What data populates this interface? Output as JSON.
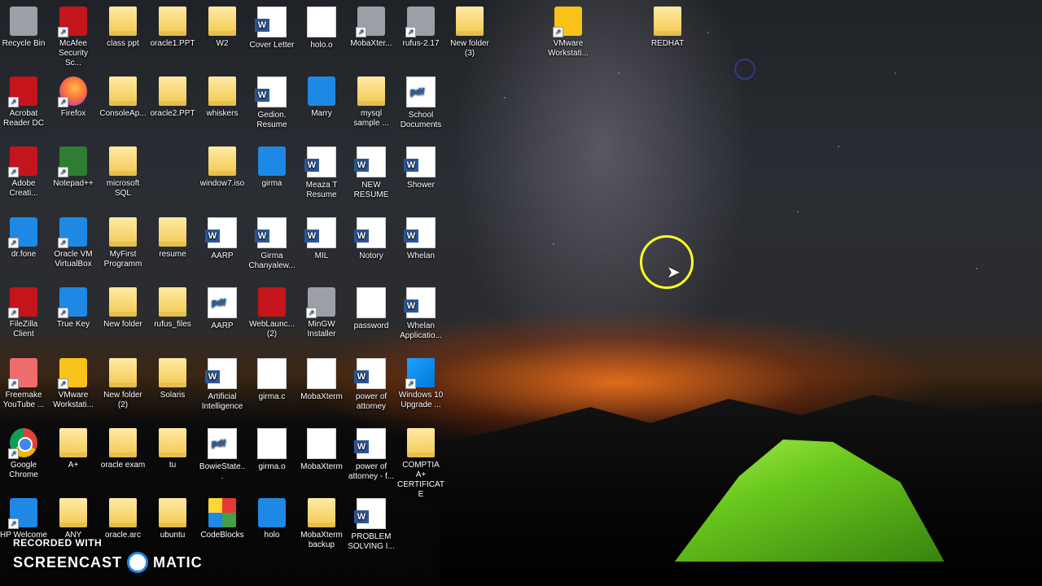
{
  "desktop": {
    "icons": [
      {
        "label": "Recycle Bin",
        "type": "gray"
      },
      {
        "label": "McAfee Security Sc...",
        "type": "red"
      },
      {
        "label": "class ppt",
        "type": "folder"
      },
      {
        "label": "oracle1.PPT",
        "type": "folder"
      },
      {
        "label": "W2",
        "type": "folder"
      },
      {
        "label": "Cover Letter",
        "type": "word"
      },
      {
        "label": "holo.o",
        "type": "doc"
      },
      {
        "label": "MobaXter...",
        "type": "gray"
      },
      {
        "label": "rufus-2.17",
        "type": "gray"
      },
      {
        "label": "New folder (3)",
        "type": "folder"
      },
      {
        "label": "VMware Workstati...",
        "type": "yellow"
      },
      {
        "label": "REDHAT",
        "type": "folder"
      },
      {
        "label": "Acrobat Reader DC",
        "type": "red"
      },
      {
        "label": "Firefox",
        "type": "firefox"
      },
      {
        "label": "ConsoleAp...",
        "type": "folder"
      },
      {
        "label": "oracle2.PPT",
        "type": "folder"
      },
      {
        "label": "whiskers",
        "type": "folder"
      },
      {
        "label": "Gedion. Resume",
        "type": "word"
      },
      {
        "label": "Marry",
        "type": "blue"
      },
      {
        "label": "mysql sample ...",
        "type": "folder"
      },
      {
        "label": "School Documents",
        "type": "pdf"
      },
      {
        "label": "Adobe Creati...",
        "type": "red"
      },
      {
        "label": "Notepad++",
        "type": "green"
      },
      {
        "label": "microsoft SQL",
        "type": "folder"
      },
      {
        "label": "window7.iso",
        "type": "folder"
      },
      {
        "label": "girma",
        "type": "blue"
      },
      {
        "label": "Meaza T Resume",
        "type": "word"
      },
      {
        "label": "NEW RESUME",
        "type": "word"
      },
      {
        "label": "Shower",
        "type": "word"
      },
      {
        "label": "dr.fone",
        "type": "blue"
      },
      {
        "label": "Oracle VM VirtualBox",
        "type": "blue"
      },
      {
        "label": "MyFirst Programm",
        "type": "folder"
      },
      {
        "label": "resume",
        "type": "folder"
      },
      {
        "label": "AARP",
        "type": "word"
      },
      {
        "label": "Girma Chanyalew...",
        "type": "word"
      },
      {
        "label": "MIL",
        "type": "word"
      },
      {
        "label": "Notory",
        "type": "word"
      },
      {
        "label": "Whelan",
        "type": "word"
      },
      {
        "label": "FileZilla Client",
        "type": "red"
      },
      {
        "label": "True Key",
        "type": "blue"
      },
      {
        "label": "New folder",
        "type": "folder"
      },
      {
        "label": "rufus_files",
        "type": "folder"
      },
      {
        "label": "AARP",
        "type": "pdf"
      },
      {
        "label": "WebLaunc... (2)",
        "type": "red"
      },
      {
        "label": "MinGW Installer",
        "type": "gray"
      },
      {
        "label": "password",
        "type": "doc"
      },
      {
        "label": "Whelan Applicatio...",
        "type": "word"
      },
      {
        "label": "Freemake YouTube ...",
        "type": "pink"
      },
      {
        "label": "VMware Workstati...",
        "type": "yellow"
      },
      {
        "label": "New folder (2)",
        "type": "folder"
      },
      {
        "label": "Solaris",
        "type": "folder"
      },
      {
        "label": "Artificial Intelligence",
        "type": "word"
      },
      {
        "label": "girma.c",
        "type": "doc"
      },
      {
        "label": "MobaXterm",
        "type": "doc"
      },
      {
        "label": "power of attorney",
        "type": "word"
      },
      {
        "label": "Windows 10 Upgrade ...",
        "type": "win"
      },
      {
        "label": "Google Chrome",
        "type": "chrome"
      },
      {
        "label": "A+",
        "type": "folder"
      },
      {
        "label": "oracle exam",
        "type": "folder"
      },
      {
        "label": "tu",
        "type": "folder"
      },
      {
        "label": "BowieState...",
        "type": "pdf"
      },
      {
        "label": "girma.o",
        "type": "doc"
      },
      {
        "label": "MobaXterm",
        "type": "doc"
      },
      {
        "label": "power of attorney - f...",
        "type": "word"
      },
      {
        "label": "COMPTIA A+ CERTIFICATE",
        "type": "folder"
      },
      {
        "label": "HP Welcome",
        "type": "blue"
      },
      {
        "label": "ANY",
        "type": "folder"
      },
      {
        "label": "oracle.arc",
        "type": "folder"
      },
      {
        "label": "ubuntu",
        "type": "folder"
      },
      {
        "label": "CodeBlocks",
        "type": "multicolor"
      },
      {
        "label": "holo",
        "type": "blue"
      },
      {
        "label": "MobaXterm backup",
        "type": "folder"
      },
      {
        "label": "PROBLEM SOLVING I...",
        "type": "word"
      }
    ]
  },
  "watermark": {
    "line1": "RECORDED WITH",
    "brand_left": "SCREENCAST",
    "brand_right": "MATIC"
  }
}
